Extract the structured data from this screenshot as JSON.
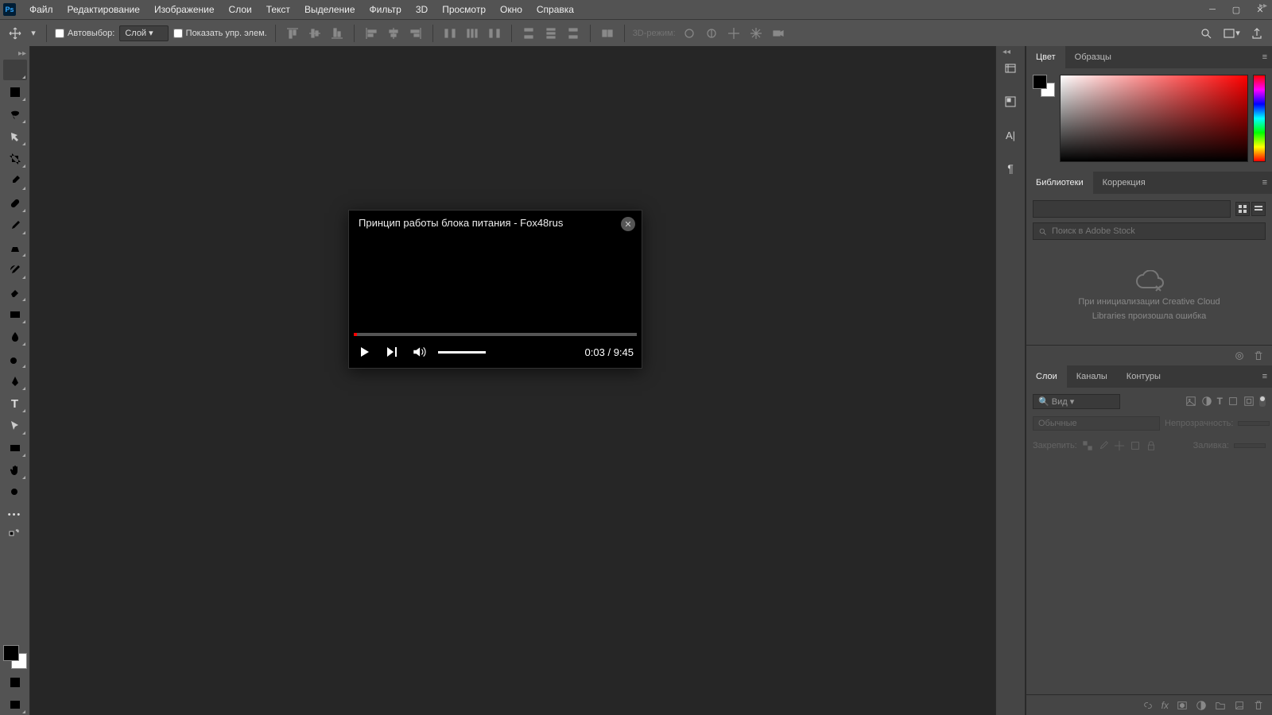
{
  "menubar": {
    "items": [
      "Файл",
      "Редактирование",
      "Изображение",
      "Слои",
      "Текст",
      "Выделение",
      "Фильтр",
      "3D",
      "Просмотр",
      "Окно",
      "Справка"
    ]
  },
  "options": {
    "autoselect_label": "Автовыбор:",
    "autoselect_mode": "Слой",
    "show_controls_label": "Показать упр. элем.",
    "mode3d_label": "3D-режим:"
  },
  "video": {
    "title": "Принцип работы блока питания - Fox48rus",
    "time_current": "0:03",
    "time_total": "9:45"
  },
  "panels": {
    "color_tab": "Цвет",
    "swatches_tab": "Образцы",
    "libraries_tab": "Библиотеки",
    "adjustments_tab": "Коррекция",
    "lib_search_placeholder": "Поиск в Adobe Stock",
    "lib_error_line1": "При инициализации Creative Cloud",
    "lib_error_line2": "Libraries произошла ошибка",
    "layers_tab": "Слои",
    "channels_tab": "Каналы",
    "paths_tab": "Контуры",
    "filter_placeholder": "Вид",
    "blend_label": "Обычные",
    "opacity_label": "Непрозрачность:",
    "lock_label": "Закрепить:",
    "fill_label": "Заливка:"
  }
}
